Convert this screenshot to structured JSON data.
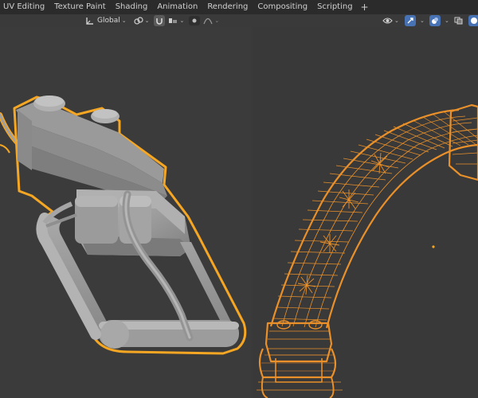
{
  "workspace_tabs": [
    "UV Editing",
    "Texture Paint",
    "Shading",
    "Animation",
    "Rendering",
    "Compositing",
    "Scripting"
  ],
  "add_workspace_label": "+",
  "header": {
    "transform_orientation": "Global"
  },
  "colors": {
    "selection_outline": "#f5a623",
    "wire": "#e9902a",
    "mesh": "#9a9a9a",
    "background": "#3a3a3a",
    "accent_blue": "#4772b3"
  },
  "icons": [
    "orientation-icon",
    "link-icon",
    "snap-icon",
    "snap-target-icon",
    "proportional-icon",
    "falloff-icon",
    "visibility-icon",
    "gizmo-icon",
    "overlay-icon",
    "xray-icon",
    "solid-shading-icon",
    "material-shading-icon"
  ]
}
